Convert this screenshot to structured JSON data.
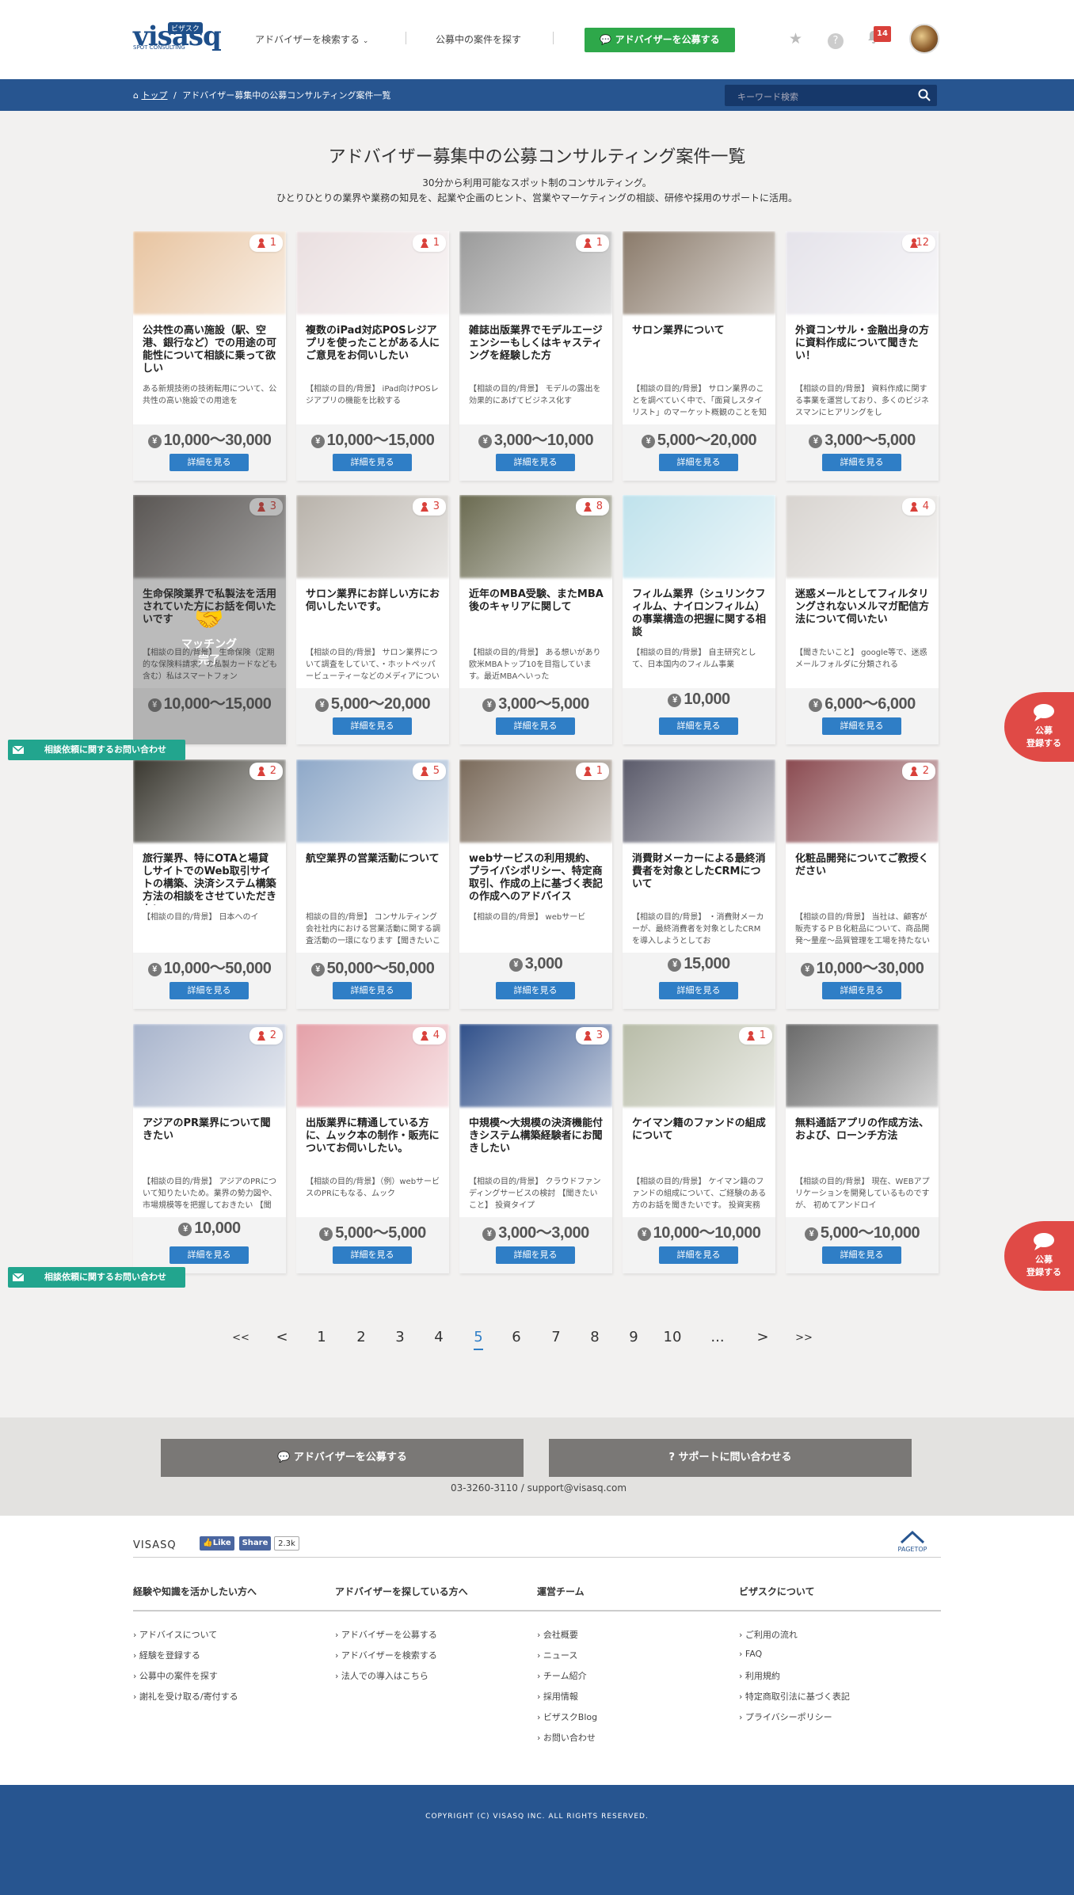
{
  "header": {
    "logo_text": "visasq",
    "logo_kana": "ビザスク",
    "logo_sub": "SPOT CONSULTING",
    "nav_search": "アドバイザーを検索する",
    "nav_projects": "公募中の案件を探す",
    "publish_button": "アドバイザーを公募する",
    "notification_count": "14"
  },
  "breadcrumb": {
    "home": "トップ",
    "current": "アドバイザー募集中の公募コンサルティング案件一覧"
  },
  "search": {
    "placeholder": "キーワード検索"
  },
  "page": {
    "title": "アドバイザー募集中の公募コンサルティング案件一覧",
    "sub1": "30分から利用可能なスポット制のコンサルティング。",
    "sub2": "ひとりひとりの業界や業務の知見を、起業や企画のヒント、営業やマーケティングの相談、研修や採用のサポートに活用。"
  },
  "detail_label": "詳細を見る",
  "yen_symbol": "¥",
  "cards": [
    {
      "count": "1",
      "title": "公共性の高い施設（駅、空港、銀行など）での用途の可能性について相談に乗って欲しい",
      "desc": "ある新規技術の技術転用について、公共性の高い施設での用途を",
      "price": "10,000〜30,000",
      "img": "#e8c4a0"
    },
    {
      "count": "1",
      "title": "複数のiPad対応POSレジアプリを使ったことがある人にご意見をお伺いしたい",
      "desc": "【相談の目的/背景】 iPad向けPOSレジアプリの機能を比較する",
      "price": "10,000〜15,000",
      "img": "#eadfe0"
    },
    {
      "count": "1",
      "title": "雑誌出版業界でモデルエージェンシーもしくはキャスティングを経験した方",
      "desc": "【相談の目的/背景】 モデルの露出を効果的にあげてビジネス化す",
      "price": "3,000〜10,000",
      "img": "#9a9a9a"
    },
    {
      "count": "",
      "title": "サロン業界について",
      "desc": "【相談の目的/背景】 サロン業界のことを調べていく中で、「面貸しスタイリスト」のマーケット概観のことを知りたく、投稿させて頂きました。【聞きたいこと】",
      "price": "5,000〜20,000",
      "img": "#8a7a6a"
    },
    {
      "count": "12",
      "title": "外資コンサル・金融出身の方に資料作成について聞きたい！",
      "desc": "【相談の目的/背景】 資料作成に関する事業を運営しており、多くのビジネスマンにヒアリングをし",
      "price": "3,000〜5,000",
      "img": "#e5e3ea"
    },
    {
      "count": "3",
      "title": "生命保険業界で私製法を活用されていた方にお話を伺いたいです",
      "desc": "【相談の目的/背景】 生命保険（定期的な保険料請求）の私製カードなども含む）私はスマートフォン",
      "price": "10,000〜15,000",
      "img": "#6a6460",
      "matched": true
    },
    {
      "count": "3",
      "title": "サロン業界にお詳しい方にお伺いしたいです。",
      "desc": "【相談の目的/背景】 サロン業界について調査をしていて、・ホットペッパービューティーなどのメディアについての情報 ・メデ",
      "price": "5,000〜20,000",
      "img": "#b8b2aa"
    },
    {
      "count": "8",
      "title": "近年のMBA受験、またMBA後のキャリアに関して",
      "desc": "【相談の目的/背景】 ある想いがあり欧米MBAトップ10を目指しています。最近MBAへいった",
      "price": "3,000〜5,000",
      "img": "#6a6a50"
    },
    {
      "count": "",
      "title": "フィルム業界（シュリンクフィルム、ナイロンフィルム）の事業構造の把握に関する相談",
      "desc": "【相談の目的/背景】 自主研究として、日本国内のフィルム事業",
      "price": "10,000",
      "img": "#bfe2ec"
    },
    {
      "count": "4",
      "title": "迷惑メールとしてフィルタリングされないメルマガ配信方法について伺いたい",
      "desc": "【聞きたいこと】 google等で、迷惑メールフォルダに分類される",
      "price": "6,000〜6,000",
      "img": "#d8d4d0"
    },
    {
      "count": "2",
      "title": "旅行業界、特にOTAと場貸しサイトでのWeb取引サイトの構築、決済システム構築方法の相談をさせていただきたい。",
      "desc": "【相談の目的/背景】 日本へのイ",
      "price": "10,000〜50,000",
      "img": "#3a3830"
    },
    {
      "count": "5",
      "title": "航空業界の営業活動について",
      "desc": "相談の目的/背景】 コンサルティング会社社内における営業活動に関する調査活動の一環になります【聞きたいこと】 航空業界にお",
      "price": "50,000〜50,000",
      "img": "#8ea8c8"
    },
    {
      "count": "1",
      "title": "webサービスの利用規約、プライバシポリシー、特定商取引、作成の上に基づく表記の作成へのアドバイス",
      "desc": "【相談の目的/背景】 webサービ",
      "price": "3,000",
      "img": "#7a6a5a"
    },
    {
      "count": "",
      "title": "消費財メーカーによる最終消費者を対象としたCRMについて",
      "desc": "【相談の目的/背景】 ・消費財メーカーが、最終消費者を対象としたCRMを導入しようとしてお",
      "price": "15,000",
      "img": "#5a5a6a"
    },
    {
      "count": "2",
      "title": "化粧品開発についてご教授ください",
      "desc": "【相談の目的/背景】 当社は、顧客が販売するＰＢ化粧品について、商品開発〜量産〜品質管理を工場を持たない商社の立場で請け",
      "price": "10,000〜30,000",
      "img": "#8a4a50"
    },
    {
      "count": "2",
      "title": "アジアのPR業界について聞きたい",
      "desc": "【相談の目的/背景】 アジアのPRについて知りたいため。業界の勢力図や、市場規模等を把握しておきたい 【聞きたいこと】・業界",
      "price": "10,000",
      "img": "#a8b4cc"
    },
    {
      "count": "4",
      "title": "出版業界に精通している方に、ムック本の制作・販売についてお伺いしたい。",
      "desc": "【相談の目的/背景】（例）webサービスのPRにもなる、ムック",
      "price": "5,000〜5,000",
      "img": "#e4a0a8"
    },
    {
      "count": "3",
      "title": "中規模〜大規模の決済機能付きシステム構築経験者にお聞きしたい",
      "desc": "【相談の目的/背景】 クラウドファンディングサービスの検討 【聞きたいこと】 投資タイプ",
      "price": "3,000〜3,000",
      "img": "#30508a"
    },
    {
      "count": "1",
      "title": "ケイマン籍のファンドの組成について",
      "desc": "【相談の目的/背景】 ケイマン籍のファンドの組成について、ご経験のある方のお話を聞きたいです。 投資実務よりはファンドの",
      "price": "10,000〜10,000",
      "img": "#b8bca8"
    },
    {
      "count": "",
      "title": "無料通話アプリの作成方法、および、ローンチ方法",
      "desc": "【相談の目的/背景】 現在、WEBアプリケーションを開発しているものですが、 初めてアンドロイ",
      "price": "5,000〜10,000",
      "img": "#6a6a6a"
    }
  ],
  "match_label": "マッチング\n完了",
  "cta_label": "公募\n登録する",
  "mail_label": "相談依頼に関するお問い合わせ",
  "pagination": [
    "<<",
    "<",
    "1",
    "2",
    "3",
    "4",
    "5",
    "6",
    "7",
    "8",
    "9",
    "10",
    "...",
    ">",
    ">>"
  ],
  "pagination_current": "5",
  "bottom": {
    "publish": "アドバイザーを公募する",
    "support": "サポートに問い合わせる",
    "contact": "03-3260-3110 / support@visasq.com"
  },
  "footer": {
    "brand": "VISASQ",
    "like": "Like",
    "share": "Share",
    "share_count": "2.3k",
    "pagetop": "PAGETOP",
    "cols": [
      {
        "title": "経験や知識を活かしたい方へ",
        "links": [
          "アドバイスについて",
          "経験を登録する",
          "公募中の案件を探す",
          "謝礼を受け取る/寄付する"
        ]
      },
      {
        "title": "アドバイザーを探している方へ",
        "links": [
          "アドバイザーを公募する",
          "アドバイザーを検索する",
          "法人での導入はこちら"
        ]
      },
      {
        "title": "運営チーム",
        "links": [
          "会社概要",
          "ニュース",
          "チーム紹介",
          "採用情報",
          "ビザスクBlog",
          "お問い合わせ"
        ]
      },
      {
        "title": "ビザスクについて",
        "links": [
          "ご利用の流れ",
          "FAQ",
          "利用規約",
          "特定商取引法に基づく表記",
          "プライバシーポリシー"
        ]
      }
    ],
    "copyright": "COPYRIGHT (C) VISASQ INC. ALL RIGHTS RESERVED."
  },
  "colors": {
    "brand": "#275590",
    "green": "#2ea84a",
    "red": "#e04a46",
    "teal": "#22a58e",
    "blue": "#2f7ec6"
  }
}
